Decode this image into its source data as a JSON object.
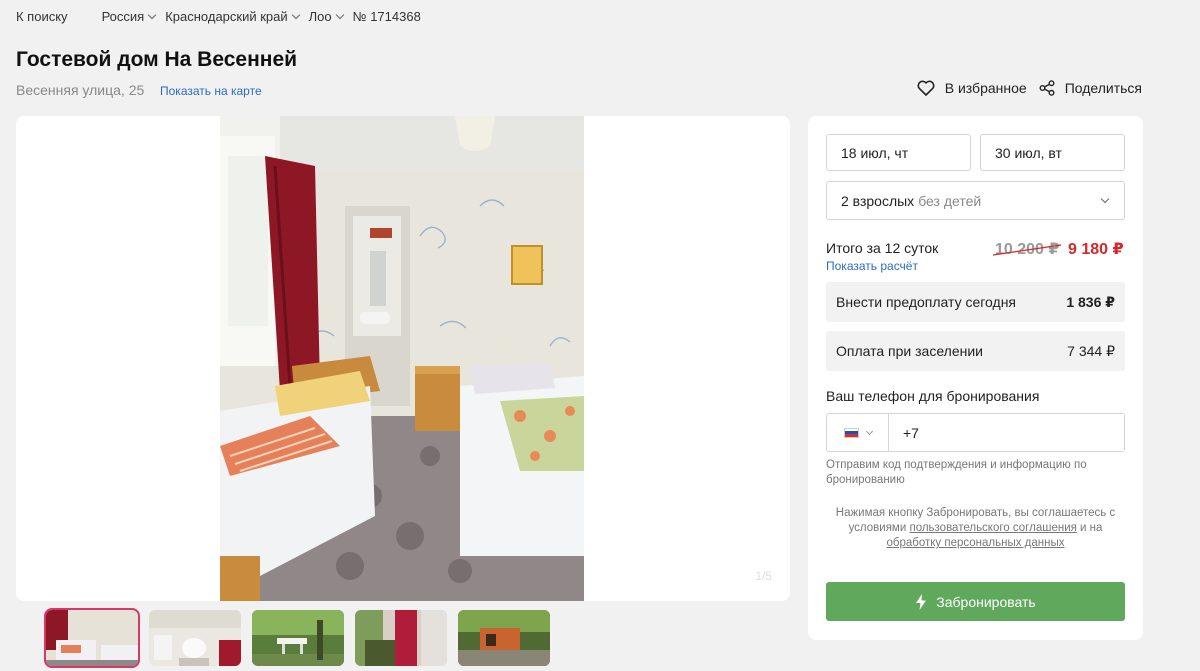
{
  "breadcrumbs": {
    "back": "К поиску",
    "items": [
      "Россия",
      "Краснодарский край",
      "Лоо"
    ],
    "listing_id": "№ 1714368"
  },
  "header": {
    "title": "Гостевой дом На Весенней",
    "address": "Весенняя улица, 25",
    "map_link": "Показать на карте",
    "favorite": "В избранное",
    "share": "Поделиться"
  },
  "icons": [
    "heart-icon",
    "share-icon",
    "chevron-down-icon",
    "lightning-icon"
  ],
  "gallery": {
    "counter": "1/5",
    "thumbnail_count": 5
  },
  "booking": {
    "checkin": "18 июл, чт",
    "checkout": "30 июл, вт",
    "guests_adults": "2 взрослых",
    "guests_children": "без детей",
    "total_label": "Итого за 12 суток",
    "show_calc": "Показать расчёт",
    "price_old": "10 200 ₽",
    "price_new": "9 180 ₽",
    "prepay_label": "Внести предоплату сегодня",
    "prepay_amount": "1 836 ₽",
    "onsite_label": "Оплата при заселении",
    "onsite_amount": "7 344 ₽",
    "phone_label": "Ваш телефон для бронирования",
    "phone_value": "+7",
    "phone_hint": "Отправим код подтверждения и информацию по бронированию",
    "agree_prefix": "Нажимая кнопку Забронировать, вы соглашаетесь с условиями",
    "agree_link1": "пользовательского соглашения",
    "agree_mid": "и на",
    "agree_link2": "обработку персональных данных",
    "book_button": "Забронировать"
  },
  "colors": {
    "accent_green": "#5fa85c",
    "price_red": "#d4282b",
    "link_blue": "#2a6cc2",
    "thumb_active_border": "#d7386a"
  }
}
